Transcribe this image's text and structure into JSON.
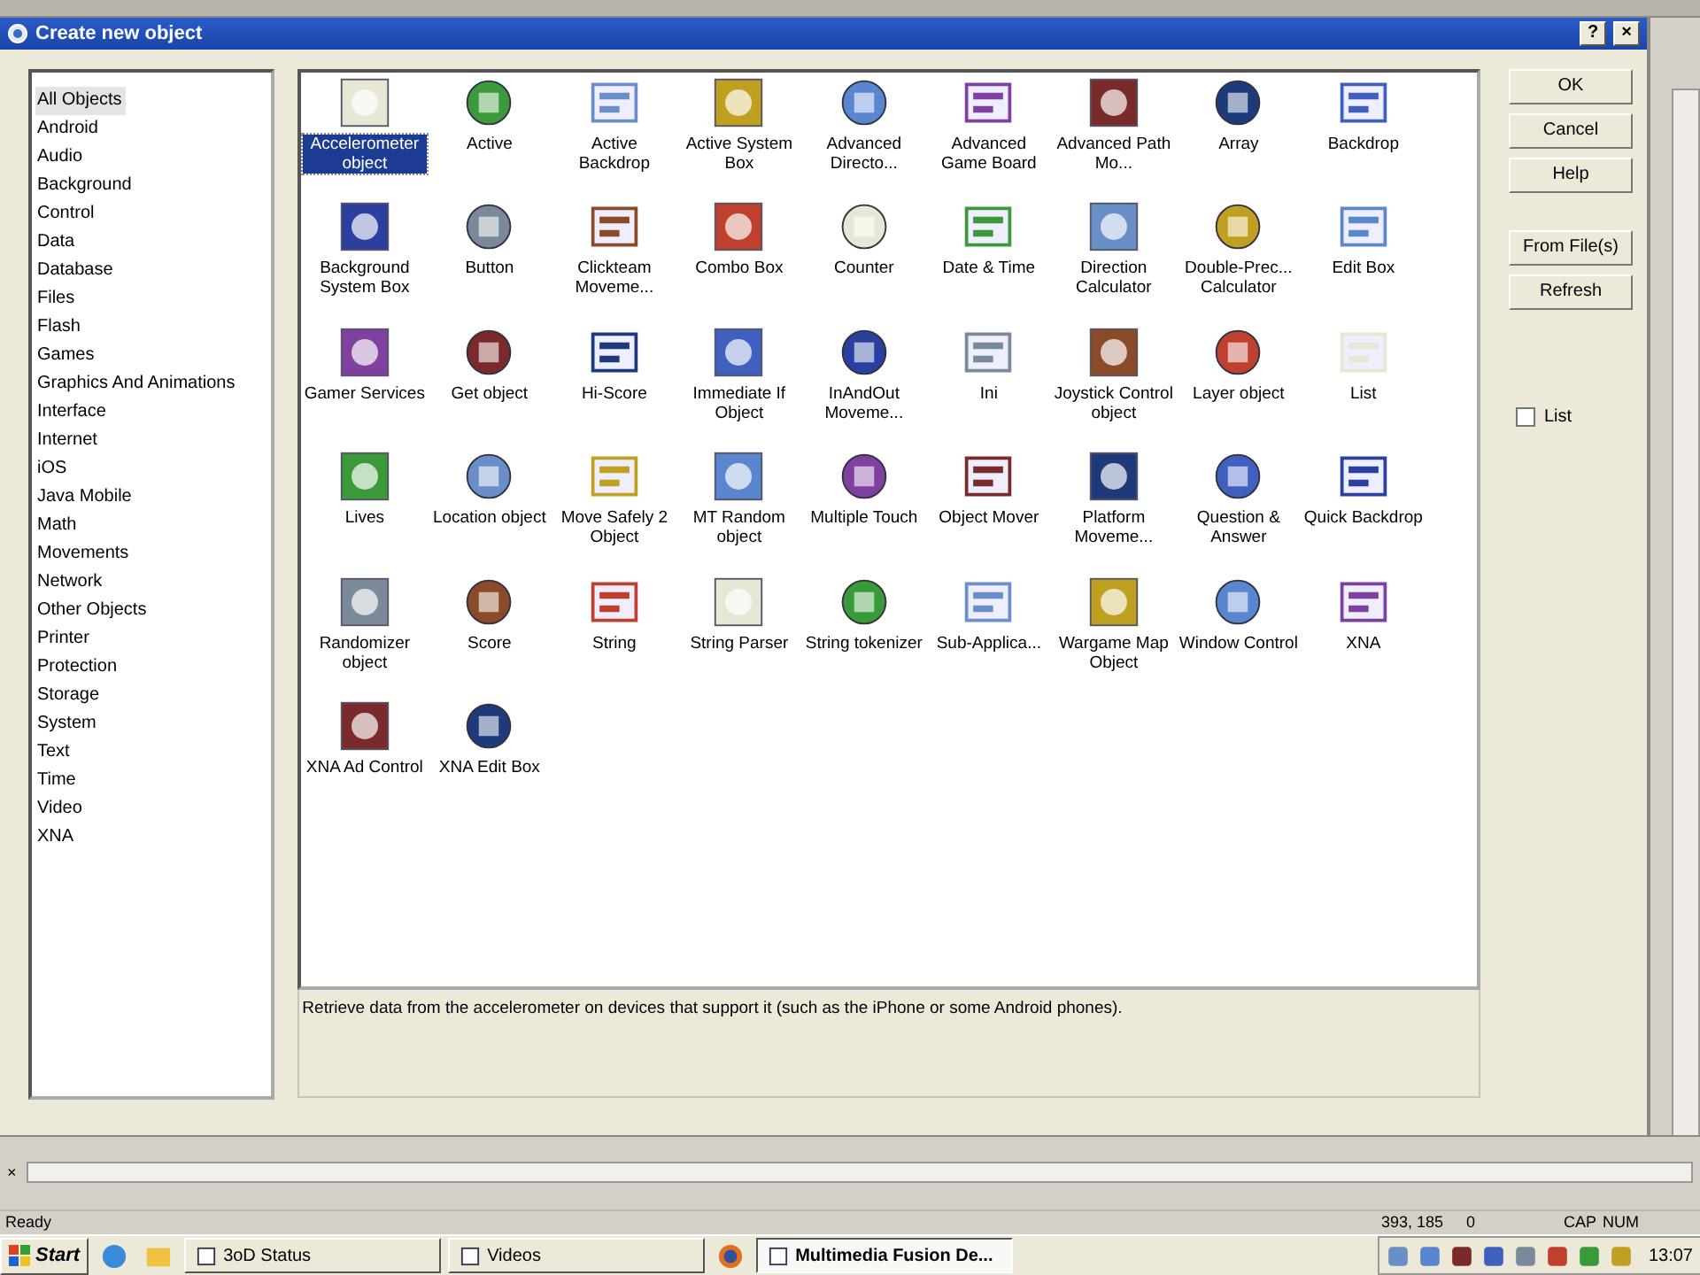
{
  "window": {
    "title": "Create new object",
    "help_button": "?",
    "close_button": "×"
  },
  "categories": [
    {
      "label": "All Objects",
      "selected": true
    },
    {
      "label": "Android",
      "selected": false
    },
    {
      "label": "Audio",
      "selected": false
    },
    {
      "label": "Background",
      "selected": false
    },
    {
      "label": "Control",
      "selected": false
    },
    {
      "label": "Data",
      "selected": false
    },
    {
      "label": "Database",
      "selected": false
    },
    {
      "label": "Files",
      "selected": false
    },
    {
      "label": "Flash",
      "selected": false
    },
    {
      "label": "Games",
      "selected": false
    },
    {
      "label": "Graphics And Animations",
      "selected": false
    },
    {
      "label": "Interface",
      "selected": false
    },
    {
      "label": "Internet",
      "selected": false
    },
    {
      "label": "iOS",
      "selected": false
    },
    {
      "label": "Java Mobile",
      "selected": false
    },
    {
      "label": "Math",
      "selected": false
    },
    {
      "label": "Movements",
      "selected": false
    },
    {
      "label": "Network",
      "selected": false
    },
    {
      "label": "Other Objects",
      "selected": false
    },
    {
      "label": "Printer",
      "selected": false
    },
    {
      "label": "Protection",
      "selected": false
    },
    {
      "label": "Storage",
      "selected": false
    },
    {
      "label": "System",
      "selected": false
    },
    {
      "label": "Text",
      "selected": false
    },
    {
      "label": "Time",
      "selected": false
    },
    {
      "label": "Video",
      "selected": false
    },
    {
      "label": "XNA",
      "selected": false
    }
  ],
  "objects": [
    {
      "label": "Accelerometer object",
      "selected": true
    },
    {
      "label": "Active",
      "selected": false
    },
    {
      "label": "Active Backdrop",
      "selected": false
    },
    {
      "label": "Active System Box",
      "selected": false
    },
    {
      "label": "Advanced Directo...",
      "selected": false
    },
    {
      "label": "Advanced Game Board",
      "selected": false
    },
    {
      "label": "Advanced Path Mo...",
      "selected": false
    },
    {
      "label": "Array",
      "selected": false
    },
    {
      "label": "Backdrop",
      "selected": false
    },
    {
      "label": "Background System Box",
      "selected": false
    },
    {
      "label": "Button",
      "selected": false
    },
    {
      "label": "Clickteam Moveme...",
      "selected": false
    },
    {
      "label": "Combo Box",
      "selected": false
    },
    {
      "label": "Counter",
      "selected": false
    },
    {
      "label": "Date & Time",
      "selected": false
    },
    {
      "label": "Direction Calculator",
      "selected": false
    },
    {
      "label": "Double-Prec... Calculator",
      "selected": false
    },
    {
      "label": "Edit Box",
      "selected": false
    },
    {
      "label": "Gamer Services",
      "selected": false
    },
    {
      "label": "Get object",
      "selected": false
    },
    {
      "label": "Hi-Score",
      "selected": false
    },
    {
      "label": "Immediate If Object",
      "selected": false
    },
    {
      "label": "InAndOut Moveme...",
      "selected": false
    },
    {
      "label": "Ini",
      "selected": false
    },
    {
      "label": "Joystick Control object",
      "selected": false
    },
    {
      "label": "Layer object",
      "selected": false
    },
    {
      "label": "List",
      "selected": false
    },
    {
      "label": "Lives",
      "selected": false
    },
    {
      "label": "Location object",
      "selected": false
    },
    {
      "label": "Move Safely 2 Object",
      "selected": false
    },
    {
      "label": "MT Random object",
      "selected": false
    },
    {
      "label": "Multiple Touch",
      "selected": false
    },
    {
      "label": "Object Mover",
      "selected": false
    },
    {
      "label": "Platform Moveme...",
      "selected": false
    },
    {
      "label": "Question & Answer",
      "selected": false
    },
    {
      "label": "Quick Backdrop",
      "selected": false
    },
    {
      "label": "Randomizer object",
      "selected": false
    },
    {
      "label": "Score",
      "selected": false
    },
    {
      "label": "String",
      "selected": false
    },
    {
      "label": "String Parser",
      "selected": false
    },
    {
      "label": "String tokenizer",
      "selected": false
    },
    {
      "label": "Sub-Applica...",
      "selected": false
    },
    {
      "label": "Wargame Map Object",
      "selected": false
    },
    {
      "label": "Window Control",
      "selected": false
    },
    {
      "label": "XNA",
      "selected": false
    },
    {
      "label": "XNA Ad Control",
      "selected": false
    },
    {
      "label": "XNA Edit Box",
      "selected": false
    }
  ],
  "description": "Retrieve data from the accelerometer on devices that support it (such as the iPhone or some Android phones).",
  "buttons": [
    "OK",
    "Cancel",
    "Help",
    "From File(s)",
    "Refresh"
  ],
  "list_option": {
    "label": "List",
    "checked": false
  },
  "bottom_panel": {
    "close": "×"
  },
  "status_bar": {
    "text": "Ready",
    "coords": "393, 185",
    "value": "0",
    "caps": "CAP",
    "num": "NUM"
  },
  "taskbar": {
    "start": "Start",
    "tasks": [
      {
        "label": "3oD Status",
        "selected": false
      },
      {
        "label": "Videos",
        "selected": false
      },
      {
        "label": "Multimedia Fusion De...",
        "selected": true
      }
    ],
    "clock": "13:07"
  }
}
